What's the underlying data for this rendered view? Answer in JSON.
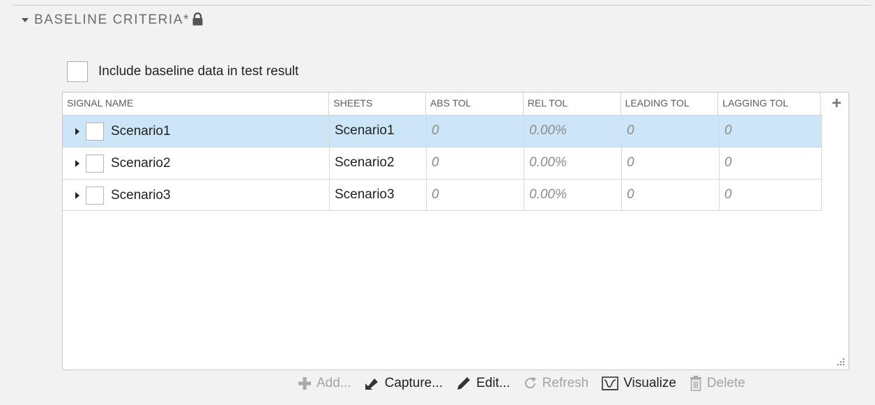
{
  "section": {
    "title": "BASELINE CRITERIA*",
    "caret_icon": "caret-down-icon",
    "lock_icon": "lock-icon"
  },
  "include_option": {
    "label": "Include baseline data in test result",
    "checked": false
  },
  "table": {
    "columns": [
      "SIGNAL NAME",
      "SHEETS",
      "ABS TOL",
      "REL TOL",
      "LEADING TOL",
      "LAGGING TOL"
    ],
    "add_column_icon": "plus-icon",
    "rows": [
      {
        "signal_name": "Scenario1",
        "sheets": "Scenario1",
        "abs_tol": "0",
        "rel_tol": "0.00%",
        "leading_tol": "0",
        "lagging_tol": "0",
        "selected": true
      },
      {
        "signal_name": "Scenario2",
        "sheets": "Scenario2",
        "abs_tol": "0",
        "rel_tol": "0.00%",
        "leading_tol": "0",
        "lagging_tol": "0",
        "selected": false
      },
      {
        "signal_name": "Scenario3",
        "sheets": "Scenario3",
        "abs_tol": "0",
        "rel_tol": "0.00%",
        "leading_tol": "0",
        "lagging_tol": "0",
        "selected": false
      }
    ],
    "selection_color": "#cde6f7"
  },
  "toolbar": {
    "add": "Add...",
    "capture": "Capture...",
    "edit": "Edit...",
    "refresh": "Refresh",
    "visualize": "Visualize",
    "delete": "Delete"
  },
  "colors": {
    "background": "#f2f2f2",
    "disabled_text": "#a3a3a3",
    "icon_dark": "#333333"
  }
}
